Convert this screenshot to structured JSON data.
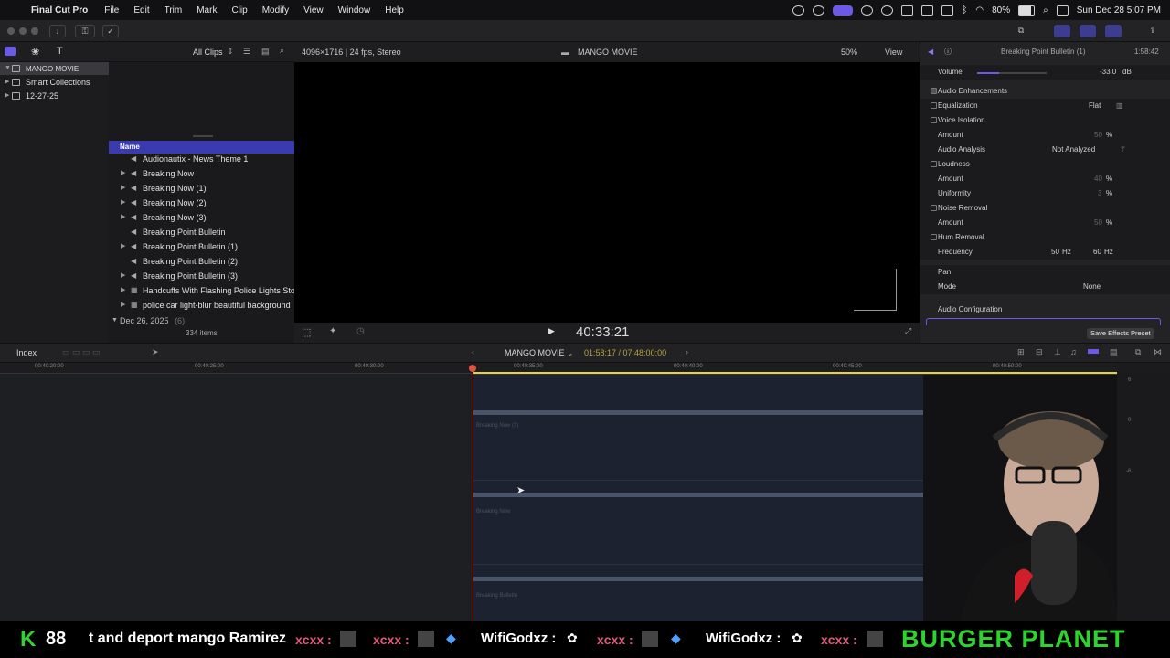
{
  "menubar": {
    "app": "Final Cut Pro",
    "items": [
      "File",
      "Edit",
      "Trim",
      "Mark",
      "Clip",
      "Modify",
      "View",
      "Window",
      "Help"
    ],
    "battery": "80%",
    "datetime": "Sun Dec 28  5:07 PM"
  },
  "browser": {
    "filter": "All Clips",
    "library": {
      "name": "MANGO MOVIE",
      "items": [
        {
          "label": "Smart Collections"
        },
        {
          "label": "12-27-25"
        }
      ]
    },
    "column_name": "Name",
    "clips": [
      "Audionautix - News Theme 1",
      "Breaking Now",
      "Breaking Now (1)",
      "Breaking Now (2)",
      "Breaking Now (3)",
      "Breaking Point Bulletin",
      "Breaking Point Bulletin (1)",
      "Breaking Point Bulletin (2)",
      "Breaking Point Bulletin (3)",
      "Handcuffs With Flashing Police Lights Sto",
      "police car light-blur beautiful background"
    ],
    "group_label": "Dec 26, 2025",
    "group_count": "(6)",
    "item_count": "334 items"
  },
  "viewer": {
    "format": "4096×1716 | 24 fps, Stereo",
    "project": "MANGO MOVIE",
    "zoom": "50%",
    "view_label": "View",
    "timecode": "40:33:21"
  },
  "inspector": {
    "title": "Breaking Point Bulletin (1)",
    "duration": "1:58:42",
    "volume_label": "Volume",
    "volume_value": "-33.0",
    "volume_unit": "dB",
    "volume_level": 0.32,
    "enhancements": "Audio Enhancements",
    "equalization": "Equalization",
    "eq_value": "Flat",
    "voice_isolation": "Voice Isolation",
    "amount": "Amount",
    "vi_amount": "50",
    "percent": "%",
    "audio_analysis": "Audio Analysis",
    "analysis_value": "Not Analyzed",
    "loudness": "Loudness",
    "loud_amount": "40",
    "uniformity": "Uniformity",
    "uniformity_value": "3",
    "noise_removal": "Noise Removal",
    "noise_amount": "50",
    "hum_removal": "Hum Removal",
    "frequency": "Frequency",
    "freq_50": "50",
    "freq_60": "60",
    "hz": "Hz",
    "pan": "Pan",
    "mode": "Mode",
    "mode_value": "None",
    "audio_config": "Audio Configuration",
    "save_preset": "Save Effects Preset"
  },
  "timeline": {
    "index_label": "Index",
    "project": "MANGO MOVIE",
    "position": "01:58:17 / 07:48:00:00",
    "ruler": [
      "00:40:20:00",
      "00:40:25:00",
      "00:40:30:00",
      "00:40:35:00",
      "00:40:40:00",
      "00:40:45:00",
      "00:40:50:00"
    ],
    "clip_labels": [
      "Breaking Now (3)",
      "Breaking Now",
      "Breaking Bulletin"
    ],
    "meter_labels": [
      "6",
      "0",
      "-6"
    ]
  },
  "ticker": {
    "count": "88",
    "message": "t and deport mango Ramirez",
    "users": [
      "xcxx :",
      "xcxx :",
      "WifiGodxz :",
      "WifiGodxz :",
      "xcxx :"
    ],
    "banner": "BURGER PLANET"
  },
  "colors": {
    "accent": "#6b5ae8",
    "playhead": "#e0533f",
    "ticker_green": "#2fd32f"
  }
}
